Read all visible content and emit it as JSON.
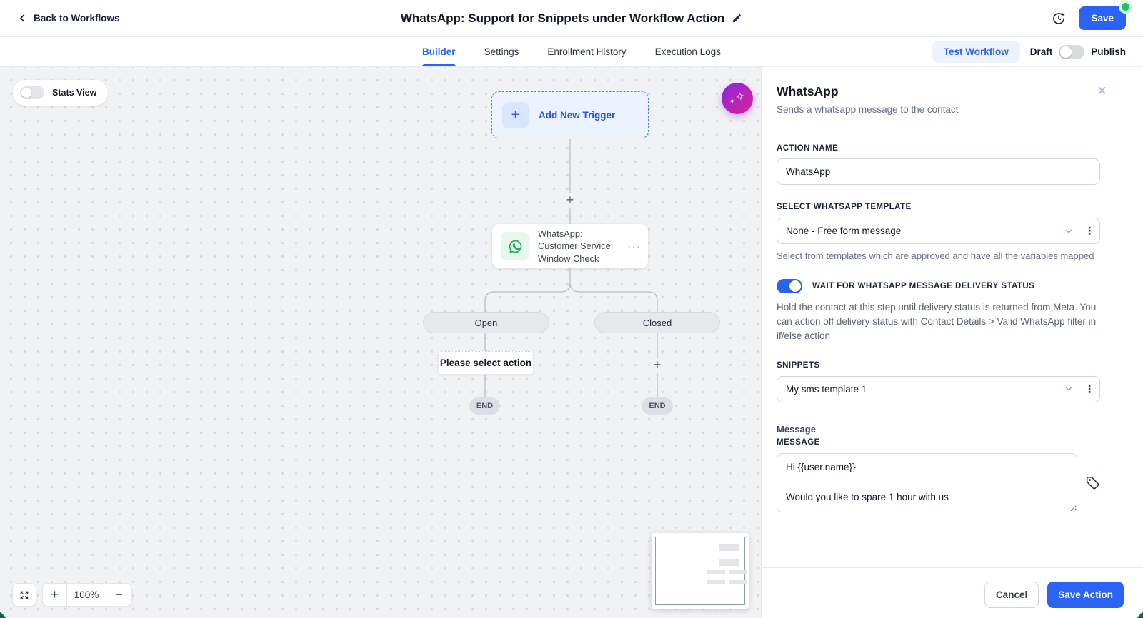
{
  "header": {
    "back_label": "Back to Workflows",
    "title": "WhatsApp: Support for Snippets under Workflow Action",
    "save_label": "Save"
  },
  "tabs": {
    "items": [
      {
        "label": "Builder",
        "active": true
      },
      {
        "label": "Settings",
        "active": false
      },
      {
        "label": "Enrollment History",
        "active": false
      },
      {
        "label": "Execution Logs",
        "active": false
      }
    ],
    "test_workflow_label": "Test Workflow",
    "draft_label": "Draft",
    "publish_label": "Publish"
  },
  "canvas": {
    "stats_view_label": "Stats View",
    "add_new_trigger_label": "Add New Trigger",
    "node_title": "WhatsApp: Customer Service Window Check",
    "node_menu": "···",
    "branch_open_label": "Open",
    "branch_closed_label": "Closed",
    "please_select_label": "Please select action",
    "end_label": "END",
    "zoom_level": "100%",
    "plus_glyph": "+",
    "minus_glyph": "−"
  },
  "panel": {
    "title": "WhatsApp",
    "subtitle": "Sends a whatsapp message to the contact",
    "close_glyph": "✕",
    "action_name_label": "ACTION NAME",
    "action_name_value": "WhatsApp",
    "template_label": "SELECT WHATSAPP TEMPLATE",
    "template_value": "None - Free form message",
    "template_help": "Select from templates which are approved and have all the variables mapped",
    "wait_toggle_label": "WAIT FOR WHATSAPP MESSAGE DELIVERY STATUS",
    "wait_toggle_help": "Hold the contact at this step until delivery status is returned from Meta. You can action off delivery status with Contact Details > Valid WhatsApp filter in if/else action",
    "snippets_label": "SNIPPETS",
    "snippets_value": "My sms template 1",
    "message_group_label": "Message",
    "message_label": "MESSAGE",
    "message_value": "Hi {{user.name}}\n\nWould you like to spare 1 hour with us",
    "cancel_label": "Cancel",
    "save_action_label": "Save Action"
  },
  "colors": {
    "accent_blue": "#2b63f5",
    "whatsapp_green": "#1fa855",
    "ai_gradient_start": "#8f27d8",
    "ai_gradient_end": "#d6219c",
    "save_status_green": "#21c55d",
    "canvas_bg": "#f1f2f4",
    "connector_gray": "#b6bac2"
  }
}
